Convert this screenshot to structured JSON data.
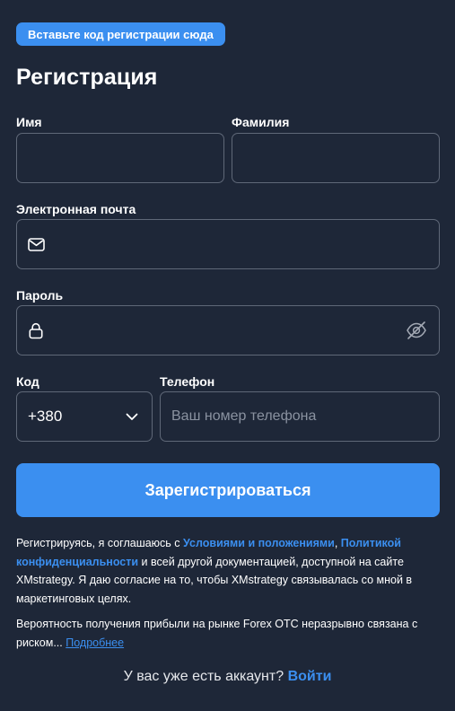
{
  "badge": {
    "label": "Вставьте код регистрации сюда"
  },
  "form": {
    "title": "Регистрация",
    "first_name": {
      "label": "Имя",
      "value": ""
    },
    "last_name": {
      "label": "Фамилия",
      "value": ""
    },
    "email": {
      "label": "Электронная почта",
      "value": "",
      "icon": "mail-icon"
    },
    "password": {
      "label": "Пароль",
      "value": "",
      "icon": "lock-icon",
      "toggle_icon": "eye-off-icon"
    },
    "code": {
      "label": "Код",
      "value": "+380",
      "icon": "chevron-down-icon"
    },
    "phone": {
      "label": "Телефон",
      "placeholder": "Ваш номер телефона",
      "value": ""
    },
    "submit_label": "Зарегистрироваться"
  },
  "legal": {
    "p1_part1": "Регистрируясь, я соглашаюсь с ",
    "p1_link1": "Условиями и положениями",
    "p1_sep": ", ",
    "p1_link2": "Политикой конфиденциальности",
    "p1_part2": " и всей другой документацией, доступной на сайте XMstrategy. Я даю согласие на то, чтобы XMstrategy связывалась со мной в маркетинговых целях.",
    "p2_text": "Вероятность получения прибыли на рынке Forex OTC неразрывно связана с риском... ",
    "p2_link": "Подробнее"
  },
  "footer": {
    "question": "У вас уже есть аккаунт? ",
    "login_label": "Войти"
  },
  "colors": {
    "background": "#1e2738",
    "accent": "#3b8ff0",
    "border": "#5f6878",
    "placeholder": "#8a92a0"
  }
}
